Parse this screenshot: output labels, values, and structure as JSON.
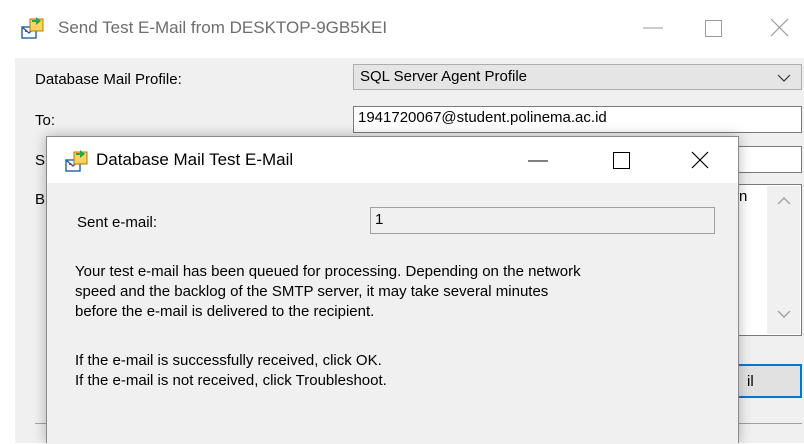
{
  "back_window": {
    "title": "Send Test E-Mail from DESKTOP-9GB5KEI",
    "profile_label": "Database Mail Profile:",
    "profile_value": "SQL Server Agent Profile",
    "to_label": "To:",
    "to_value": "1941720067@student.polinema.ac.id",
    "subject_label_partial": "S",
    "body_label_partial": "B",
    "body_text_partial": "n",
    "button_partial": "il"
  },
  "dialog": {
    "title": "Database Mail Test E-Mail",
    "sent_label": "Sent e-mail:",
    "sent_value": "1",
    "message_lines": [
      "Your test e-mail has been queued for processing.  Depending on the network",
      "speed and the backlog of the SMTP server, it may take several minutes",
      "before the e-mail is delivered to the recipient."
    ],
    "instruction_lines": [
      "If the e-mail is successfully received, click OK.",
      "If the e-mail is not received, click Troubleshoot."
    ]
  },
  "icons": {
    "app": "database-mail-icon",
    "minimize": "minimize-icon",
    "maximize": "maximize-icon",
    "close": "close-icon",
    "dropdown": "chevron-down-icon",
    "scroll_up": "scroll-up-icon",
    "scroll_down": "scroll-down-icon"
  },
  "colors": {
    "accent": "#0078d7",
    "dialog_bg": "#f0f0f0",
    "inactive_title": "#6d6d6d"
  }
}
